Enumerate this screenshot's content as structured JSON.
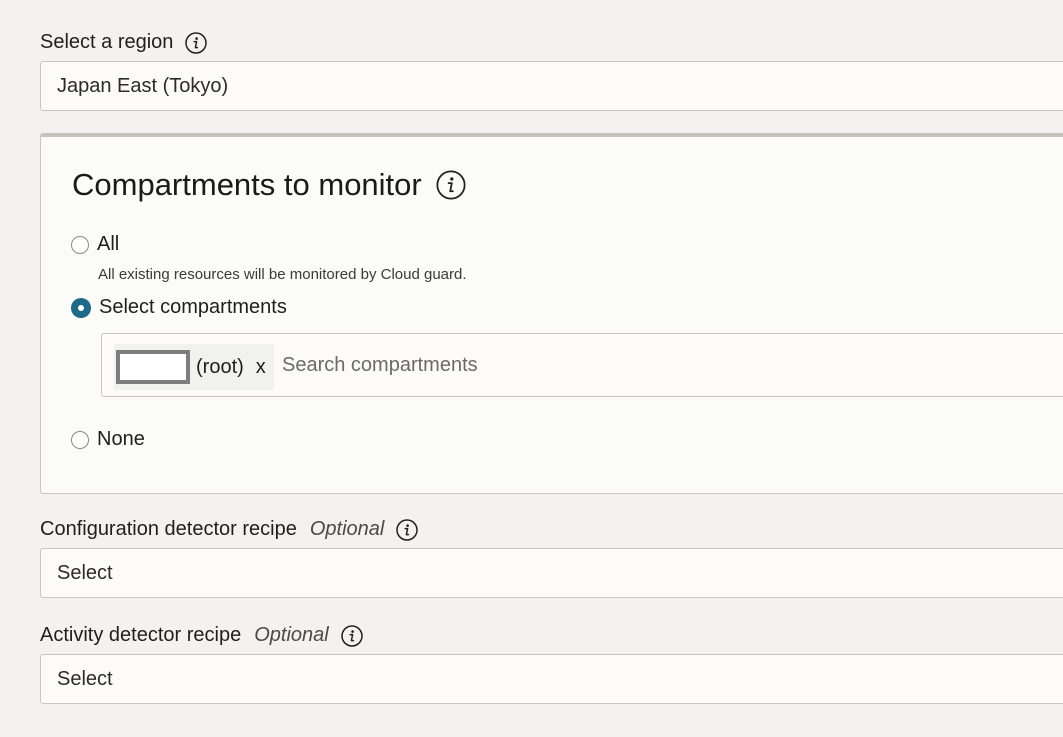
{
  "region": {
    "label": "Select a region",
    "value": "Japan East (Tokyo)",
    "info_icon": "info-icon"
  },
  "compartments": {
    "title": "Compartments to monitor",
    "info_icon": "info-icon",
    "options": [
      {
        "label": "All",
        "help": "All existing resources will be monitored by Cloud guard.",
        "selected": false
      },
      {
        "label": "Select compartments",
        "selected": true
      },
      {
        "label": "None",
        "selected": false
      }
    ],
    "chip_label": "(root)",
    "chip_remove": "x",
    "search_placeholder": "Search compartments"
  },
  "config_recipe": {
    "label": "Configuration detector recipe",
    "optional": "Optional",
    "value": "Select"
  },
  "activity_recipe": {
    "label": "Activity detector recipe",
    "optional": "Optional",
    "value": "Select"
  },
  "colors": {
    "background": "#f3f2f0",
    "accent": "#1d6a8a",
    "panel": "#fbfbfa"
  }
}
